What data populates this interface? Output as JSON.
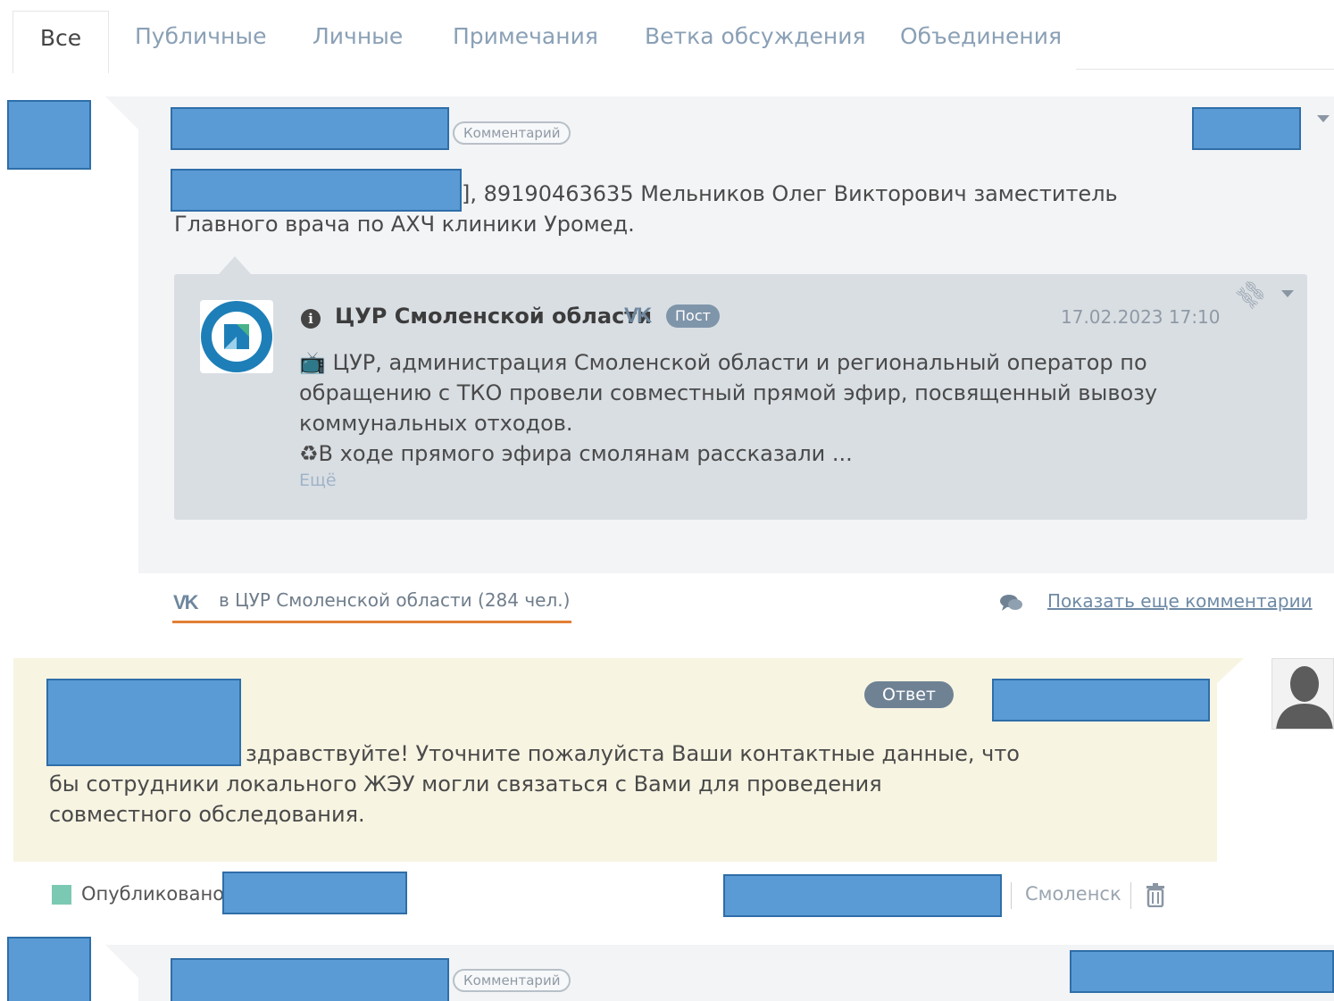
{
  "tabs": [
    {
      "label": "Все",
      "active": true
    },
    {
      "label": "Публичные",
      "active": false
    },
    {
      "label": "Личные",
      "active": false
    },
    {
      "label": "Примечания",
      "active": false
    },
    {
      "label": "Ветка обсуждения",
      "active": false
    },
    {
      "label": "Объединения",
      "active": false
    }
  ],
  "comment": {
    "badge": "Комментарий",
    "text": "], 89190463635 Мельников Олег Викторович заместитель Главного врача по АХЧ клиники Уромед."
  },
  "post": {
    "author": "ЦУР Смоленской области",
    "network_icon": "vk-icon",
    "badge": "Пост",
    "date": "17.02.2023 17:10",
    "lines": [
      "📺 ЦУР, администрация Смоленской области и региональный оператор по обращению с ТКО провели совместный прямой эфир, посвященный вывозу коммунальных отходов.",
      "♻В ходе прямого эфира смолянам рассказали ..."
    ],
    "more": "Ещё"
  },
  "group": {
    "text": "в ЦУР Смоленской области (284 чел.)"
  },
  "show_more": "Показать еще комментарии",
  "reply": {
    "badge": "Ответ",
    "text": "здравствуйте! Уточните пожалуйста Ваши контактные данные, что бы сотрудники локального ЖЭУ могли связаться с Вами для проведения совместного обследования.",
    "status": "Опубликовано",
    "city": "Смоленск"
  },
  "comment2": {
    "badge": "Комментарий"
  },
  "colors": {
    "redaction": "#5b9bd5",
    "accent_underline": "#e37f34",
    "published_status": "#7cc9b3",
    "reply_background": "#f7f4e2"
  }
}
